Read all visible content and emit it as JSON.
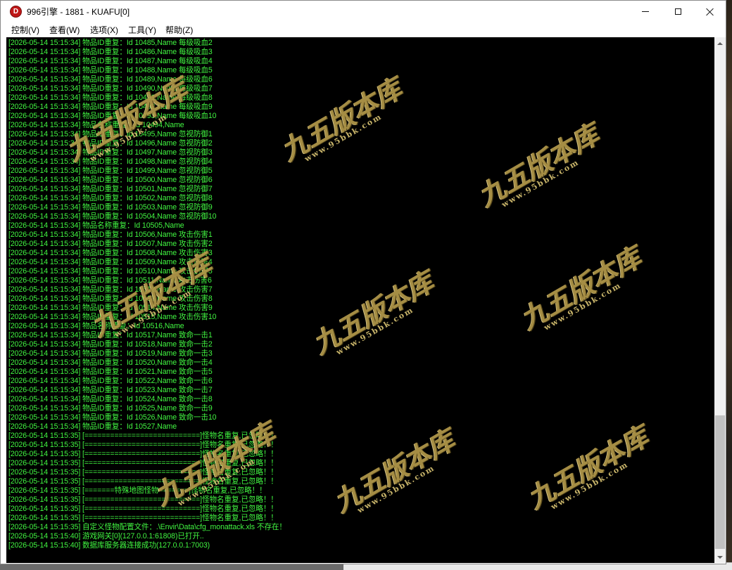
{
  "window": {
    "title": "996引擎 - 1881 - KUAFU[0]",
    "icon_letter": "D",
    "icon_name": "app-logo-icon",
    "accent_color": "#c01818"
  },
  "menu": [
    {
      "label": "控制(V)"
    },
    {
      "label": "查看(W)"
    },
    {
      "label": "选项(X)"
    },
    {
      "label": "工具(Y)"
    },
    {
      "label": "帮助(Z)"
    }
  ],
  "console": {
    "text_color": "#41f541",
    "background": "#000000",
    "lines": [
      "[2026-05-14 15:15:34] 物品ID重复：Id 10485,Name 每级吸血2",
      "[2026-05-14 15:15:34] 物品ID重复：Id 10486,Name 每级吸血3",
      "[2026-05-14 15:15:34] 物品ID重复：Id 10487,Name 每级吸血4",
      "[2026-05-14 15:15:34] 物品ID重复：Id 10488,Name 每级吸血5",
      "[2026-05-14 15:15:34] 物品ID重复：Id 10489,Name 每级吸血6",
      "[2026-05-14 15:15:34] 物品ID重复：Id 10490,Name 每级吸血7",
      "[2026-05-14 15:15:34] 物品ID重复：Id 10491,Name 每级吸血8",
      "[2026-05-14 15:15:34] 物品ID重复：Id 10492,Name 每级吸血9",
      "[2026-05-14 15:15:34] 物品ID重复：Id 10493,Name 每级吸血10",
      "[2026-05-14 15:15:34] 物品名称重复：Id 10494,Name",
      "[2026-05-14 15:15:34] 物品ID重复：Id 10495,Name 忽视防御1",
      "[2026-05-14 15:15:34] 物品ID重复：Id 10496,Name 忽视防御2",
      "[2026-05-14 15:15:34] 物品ID重复：Id 10497,Name 忽视防御3",
      "[2026-05-14 15:15:34] 物品ID重复：Id 10498,Name 忽视防御4",
      "[2026-05-14 15:15:34] 物品ID重复：Id 10499,Name 忽视防御5",
      "[2026-05-14 15:15:34] 物品ID重复：Id 10500,Name 忽视防御6",
      "[2026-05-14 15:15:34] 物品ID重复：Id 10501,Name 忽视防御7",
      "[2026-05-14 15:15:34] 物品ID重复：Id 10502,Name 忽视防御8",
      "[2026-05-14 15:15:34] 物品ID重复：Id 10503,Name 忽视防御9",
      "[2026-05-14 15:15:34] 物品ID重复：Id 10504,Name 忽视防御10",
      "[2026-05-14 15:15:34] 物品名称重复：Id 10505,Name",
      "[2026-05-14 15:15:34] 物品ID重复：Id 10506,Name 攻击伤害1",
      "[2026-05-14 15:15:34] 物品ID重复：Id 10507,Name 攻击伤害2",
      "[2026-05-14 15:15:34] 物品ID重复：Id 10508,Name 攻击伤害3",
      "[2026-05-14 15:15:34] 物品ID重复：Id 10509,Name 攻击伤害4",
      "[2026-05-14 15:15:34] 物品ID重复：Id 10510,Name 攻击伤害5",
      "[2026-05-14 15:15:34] 物品ID重复：Id 10511,Name 攻击伤害6",
      "[2026-05-14 15:15:34] 物品ID重复：Id 10512,Name 攻击伤害7",
      "[2026-05-14 15:15:34] 物品ID重复：Id 10513,Name 攻击伤害8",
      "[2026-05-14 15:15:34] 物品ID重复：Id 10514,Name 攻击伤害9",
      "[2026-05-14 15:15:34] 物品ID重复：Id 10515,Name 攻击伤害10",
      "[2026-05-14 15:15:34] 物品名称重复：Id 10516,Name",
      "[2026-05-14 15:15:34] 物品ID重复：Id 10517,Name 致命一击1",
      "[2026-05-14 15:15:34] 物品ID重复：Id 10518,Name 致命一击2",
      "[2026-05-14 15:15:34] 物品ID重复：Id 10519,Name 致命一击3",
      "[2026-05-14 15:15:34] 物品ID重复：Id 10520,Name 致命一击4",
      "[2026-05-14 15:15:34] 物品ID重复：Id 10521,Name 致命一击5",
      "[2026-05-14 15:15:34] 物品ID重复：Id 10522,Name 致命一击6",
      "[2026-05-14 15:15:34] 物品ID重复：Id 10523,Name 致命一击7",
      "[2026-05-14 15:15:34] 物品ID重复：Id 10524,Name 致命一击8",
      "[2026-05-14 15:15:34] 物品ID重复：Id 10525,Name 致命一击9",
      "[2026-05-14 15:15:34] 物品ID重复：Id 10526,Name 致命一击10",
      "[2026-05-14 15:15:34] 物品ID重复：Id 10527,Name",
      "[2026-05-14 15:15:35] [===========================]怪物名重复,已忽略！！",
      "[2026-05-14 15:15:35] [===========================]怪物名重复,已忽略！！",
      "[2026-05-14 15:15:35] [===========================]怪物名重复,已忽略！！",
      "[2026-05-14 15:15:35] [===========================]怪物名重复,已忽略！！",
      "[2026-05-14 15:15:35] [===========================]怪物名重复,已忽略！！",
      "[2026-05-14 15:15:35] [===========================]怪物名重复,已忽略！！",
      "[2026-05-14 15:15:35] [=======特殊地图怪物=======]怪物名重复,已忽略！！",
      "[2026-05-14 15:15:35] [===========================]怪物名重复,已忽略！！",
      "[2026-05-14 15:15:35] [===========================]怪物名重复,已忽略！！",
      "[2026-05-14 15:15:35] [===========================]怪物名重复,已忽略！！",
      "[2026-05-14 15:15:35] 自定义怪物配置文件：.\\Envir\\Data\\cfg_monattack.xls 不存在！",
      "[2026-05-14 15:15:40] 游戏网关[0](127.0.0.1:61808)已打开..",
      "[2026-05-14 15:15:40] 数据库服务器连接成功(127.0.0.1:7003)"
    ]
  },
  "watermark": {
    "text": "九五版本库",
    "url": "www.95bbk.com",
    "color": "#b49a4a"
  }
}
